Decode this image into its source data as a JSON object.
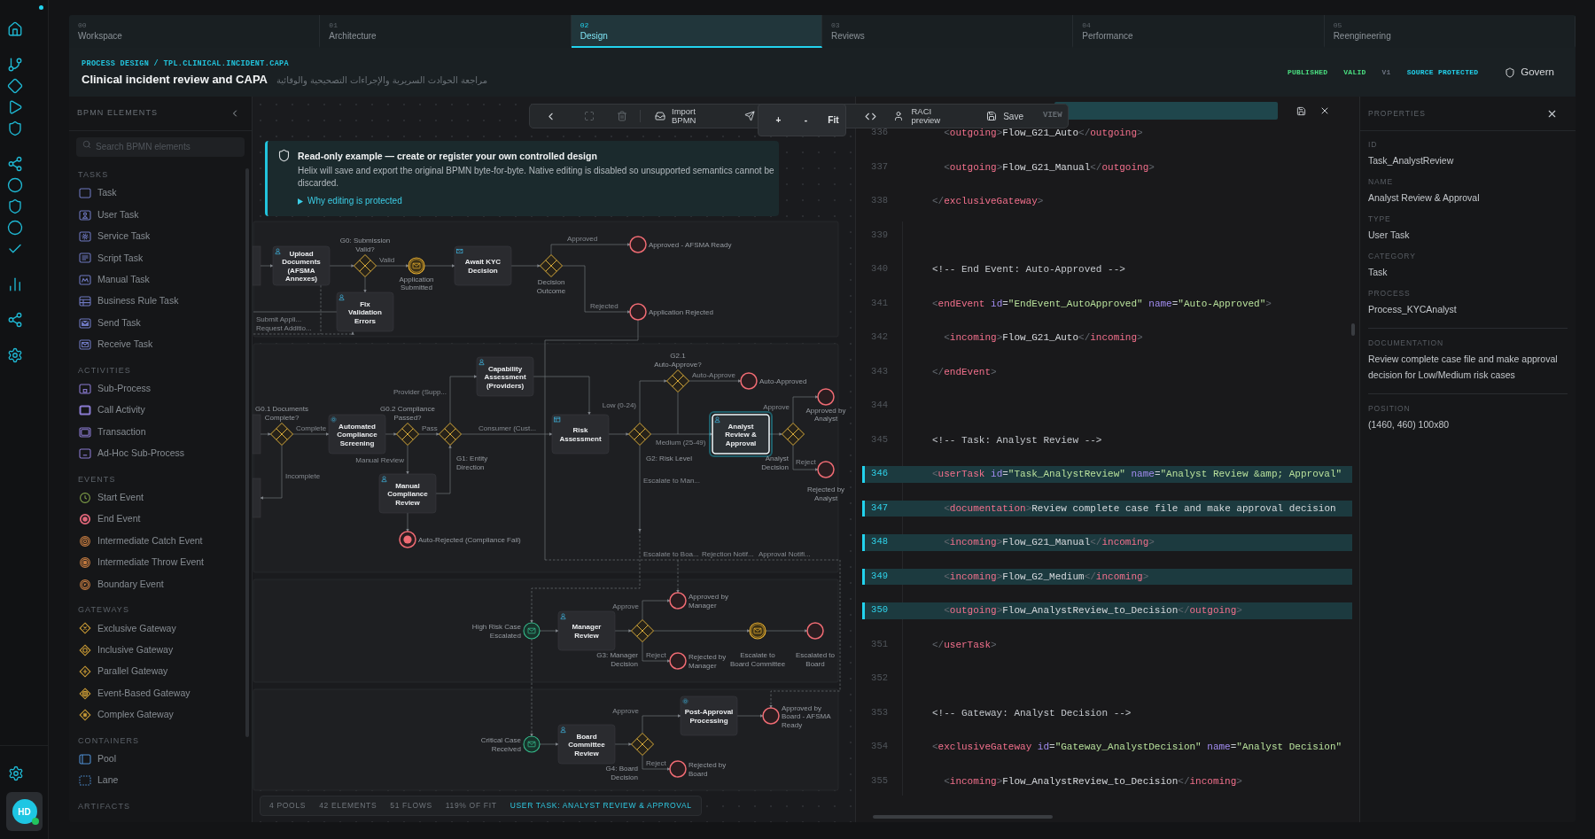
{
  "rail": {
    "avatar": {
      "initials": "HD",
      "online": true
    }
  },
  "tabs": [
    {
      "number": "00",
      "label": "Workspace",
      "selected": false
    },
    {
      "number": "01",
      "label": "Architecture",
      "selected": false
    },
    {
      "number": "02",
      "label": "Design",
      "selected": true
    },
    {
      "number": "03",
      "label": "Reviews",
      "selected": false
    },
    {
      "number": "04",
      "label": "Performance",
      "selected": false
    },
    {
      "number": "05",
      "label": "Reengineering",
      "selected": false
    }
  ],
  "header": {
    "breadcrumb": "PROCESS DESIGN / TPL.CLINICAL.INCIDENT.CAPA",
    "title": "Clinical incident review and CAPA",
    "title_arabic": "مراجعة الحوادث السريرية والإجراءات التصحيحية والوقائية",
    "badges": [
      {
        "label": "PUBLISHED",
        "color": "#4ade80"
      },
      {
        "label": "VALID",
        "color": "#4ade80"
      },
      {
        "label": "V1",
        "color": "#6b7280"
      },
      {
        "label": "SOURCE PROTECTED",
        "color": "#22d3ee"
      }
    ],
    "govern_button": "Govern"
  },
  "palette": {
    "title": "BPMN ELEMENTS",
    "search_placeholder": "Search BPMN elements",
    "sections": [
      {
        "title": "TASKS",
        "items": [
          {
            "kind": "task",
            "label": "Task"
          },
          {
            "kind": "user",
            "label": "User Task"
          },
          {
            "kind": "service",
            "label": "Service Task"
          },
          {
            "kind": "script",
            "label": "Script Task"
          },
          {
            "kind": "manual",
            "label": "Manual Task"
          },
          {
            "kind": "rule",
            "label": "Business Rule Task"
          },
          {
            "kind": "send",
            "label": "Send Task"
          },
          {
            "kind": "receive",
            "label": "Receive Task"
          }
        ]
      },
      {
        "title": "ACTIVITIES",
        "items": [
          {
            "kind": "subprocess",
            "label": "Sub-Process"
          },
          {
            "kind": "call",
            "label": "Call Activity"
          },
          {
            "kind": "transaction",
            "label": "Transaction"
          },
          {
            "kind": "adhoc",
            "label": "Ad-Hoc Sub-Process"
          }
        ]
      },
      {
        "title": "EVENTS",
        "items": [
          {
            "kind": "start",
            "label": "Start Event"
          },
          {
            "kind": "end",
            "label": "End Event"
          },
          {
            "kind": "catch",
            "label": "Intermediate Catch Event"
          },
          {
            "kind": "throw",
            "label": "Intermediate Throw Event"
          },
          {
            "kind": "boundary",
            "label": "Boundary Event"
          }
        ]
      },
      {
        "title": "GATEWAYS",
        "items": [
          {
            "kind": "exclusive",
            "label": "Exclusive Gateway"
          },
          {
            "kind": "inclusive",
            "label": "Inclusive Gateway"
          },
          {
            "kind": "parallel",
            "label": "Parallel Gateway"
          },
          {
            "kind": "eventbased",
            "label": "Event-Based Gateway"
          },
          {
            "kind": "complex",
            "label": "Complex Gateway"
          }
        ]
      },
      {
        "title": "CONTAINERS",
        "items": [
          {
            "kind": "pool",
            "label": "Pool"
          },
          {
            "kind": "lane",
            "label": "Lane"
          }
        ]
      },
      {
        "title": "ARTIFACTS"
      }
    ]
  },
  "toolbar": {
    "fullscreen_disabled": true,
    "delete_disabled": true,
    "import_label": "Import BPMN",
    "zoom_in": "+",
    "zoom_out": "-",
    "fit": "Fit",
    "raci_label": "RACI preview",
    "save_label": "Save",
    "mode": "VIEW"
  },
  "banner": {
    "title": "Read-only example — create or register your own controlled design",
    "body": "Helix will save and export the original BPMN byte-for-byte. Native editing is disabled so unsupported semantics cannot be discarded.",
    "link": "Why editing is protected"
  },
  "diagram": {
    "pools": [
      {
        "nodes": [
          {
            "kind": "gateway",
            "label": "G0: Submission Valid?",
            "selected": false
          },
          {
            "kind": "endevent",
            "label": "Approved - AFSMA Ready",
            "selected": false
          },
          {
            "kind": "usertask",
            "label": "Upload Documents (AFSMA Annexes)",
            "selected": false
          },
          {
            "kind": "receivetask",
            "label": "Await KYC Decision",
            "selected": false
          },
          {
            "kind": "messageevent",
            "label": "Application Submitted",
            "selected": false
          },
          {
            "kind": "gateway",
            "label": "Decision Outcome",
            "selected": false
          },
          {
            "kind": "usertask",
            "label": "Fix Validation Errors",
            "selected": false
          },
          {
            "kind": "endevent",
            "label": "Application Rejected",
            "selected": false
          }
        ],
        "flow_labels": [
          "Approved",
          "Valid",
          "Rejected",
          "Submit Appli...",
          "Request Additio..."
        ]
      },
      {
        "nodes": [
          {
            "kind": "gateway",
            "label": "G2.1 Auto-Approve?",
            "selected": false
          },
          {
            "kind": "usertask",
            "label": "Capability Assessment (Providers)",
            "selected": false
          },
          {
            "kind": "endevent",
            "label": "Auto-Approved",
            "selected": false
          },
          {
            "kind": "gateway",
            "label": "G0.1 Documents Complete?",
            "selected": false
          },
          {
            "kind": "gateway",
            "label": "G0.2 Compliance Passed?",
            "selected": false
          },
          {
            "kind": "endevent",
            "label": "Approved by Analyst",
            "selected": false
          },
          {
            "kind": "servicetask",
            "label": "Automated Compliance Screening",
            "selected": false
          },
          {
            "kind": "ruletask",
            "label": "Risk Assessment",
            "selected": false
          },
          {
            "kind": "usertask",
            "label": "Analyst Review & Approval",
            "selected": true
          },
          {
            "kind": "gateway",
            "label": "G1: Entity Direction",
            "selected": false
          },
          {
            "kind": "gateway",
            "label": "G2: Risk Level",
            "selected": false
          },
          {
            "kind": "gateway",
            "label": "Analyst Decision",
            "selected": false
          },
          {
            "kind": "usertask",
            "label": "Manual Compliance Review",
            "selected": false
          },
          {
            "kind": "endevent",
            "label": "Rejected by Analyst",
            "selected": false
          },
          {
            "kind": "terminateevent",
            "label": "Auto-Rejected (Compliance Fail)",
            "selected": false
          }
        ],
        "flow_labels": [
          "Auto-Approve",
          "Provider (Supp...",
          "Low (0-24)",
          "Approve",
          "Complete",
          "Pass",
          "Consumer (Cust...",
          "Medium (25-49)",
          "Manual Review",
          "Reject",
          "Incomplete",
          "Escalate to Man...",
          "Escalate to Boa...",
          "Rejection Notif...",
          "Approval Notifi..."
        ]
      },
      {
        "nodes": [
          {
            "kind": "endevent",
            "label": "Approved by Manager",
            "selected": false
          },
          {
            "kind": "messagestart",
            "label": "High Risk Case Escalated",
            "selected": false
          },
          {
            "kind": "usertask",
            "label": "Manager Review",
            "selected": false
          },
          {
            "kind": "gateway",
            "label": "G3: Manager Decision",
            "selected": false
          },
          {
            "kind": "endevent",
            "label": "Rejected by Manager",
            "selected": false
          },
          {
            "kind": "messageevent",
            "label": "Escalate to Board Committee",
            "selected": false
          },
          {
            "kind": "endevent",
            "label": "Escalated to Board",
            "selected": false
          }
        ],
        "flow_labels": [
          "Approve",
          "Reject"
        ]
      },
      {
        "nodes": [
          {
            "kind": "servicetask",
            "label": "Post-Approval Processing",
            "selected": false
          },
          {
            "kind": "endevent",
            "label": "Approved by Board - AFSMA Ready",
            "selected": false
          },
          {
            "kind": "messagestart",
            "label": "Critical Case Received",
            "selected": false
          },
          {
            "kind": "usertask",
            "label": "Board Committee Review",
            "selected": false
          },
          {
            "kind": "gateway",
            "label": "G4: Board Decision",
            "selected": false
          },
          {
            "kind": "endevent",
            "label": "Rejected by Board",
            "selected": false
          }
        ],
        "flow_labels": [
          "Approve",
          "Reject"
        ]
      }
    ]
  },
  "status_bar": {
    "stats": [
      "4 POOLS",
      "42 ELEMENTS",
      "51 FLOWS",
      "119% OF FIT"
    ],
    "selection": "USER TASK: ANALYST REVIEW & APPROVAL"
  },
  "code": {
    "lines": [
      {
        "number": "336",
        "text": "  <outgoing>Flow_G21_Auto</outgoing>",
        "highlighted": false
      },
      {
        "number": "337",
        "text": "  <outgoing>Flow_G21_Manual</outgoing>",
        "highlighted": false
      },
      {
        "number": "338",
        "text": "</exclusiveGateway>",
        "highlighted": false
      },
      {
        "number": "339",
        "highlighted": false
      },
      {
        "number": "340",
        "text": "<!-- End Event: Auto-Approved -->",
        "highlighted": false
      },
      {
        "number": "341",
        "text": "<endEvent id=\"EndEvent_AutoApproved\" name=\"Auto-Approved\">",
        "highlighted": false
      },
      {
        "number": "342",
        "text": "  <incoming>Flow_G21_Auto</incoming>",
        "highlighted": false
      },
      {
        "number": "343",
        "text": "</endEvent>",
        "highlighted": false
      },
      {
        "number": "344",
        "highlighted": false
      },
      {
        "number": "345",
        "text": "<!-- Task: Analyst Review -->",
        "highlighted": false
      },
      {
        "number": "346",
        "text": "<userTask id=\"Task_AnalystReview\" name=\"Analyst Review &amp; Approval\"",
        "highlighted": true
      },
      {
        "number": "347",
        "text": "  <documentation>Review complete case file and make approval decision",
        "highlighted": true
      },
      {
        "number": "348",
        "text": "  <incoming>Flow_G21_Manual</incoming>",
        "highlighted": true
      },
      {
        "number": "349",
        "text": "  <incoming>Flow_G2_Medium</incoming>",
        "highlighted": true
      },
      {
        "number": "350",
        "text": "  <outgoing>Flow_AnalystReview_to_Decision</outgoing>",
        "highlighted": true
      },
      {
        "number": "351",
        "text": "</userTask>",
        "highlighted": false
      },
      {
        "number": "352",
        "highlighted": false
      },
      {
        "number": "353",
        "text": "<!-- Gateway: Analyst Decision -->",
        "highlighted": false
      },
      {
        "number": "354",
        "text": "<exclusiveGateway id=\"Gateway_AnalystDecision\" name=\"Analyst Decision\"",
        "highlighted": false
      },
      {
        "number": "355",
        "text": "  <incoming>Flow_AnalystReview_to_Decision</incoming>",
        "highlighted": false
      }
    ]
  },
  "properties": {
    "title": "PROPERTIES",
    "sections": [
      {
        "fields": [
          {
            "label": "ID",
            "value": "Task_AnalystReview"
          },
          {
            "label": "NAME",
            "value": "Analyst Review & Approval"
          },
          {
            "label": "TYPE",
            "value": "User Task"
          },
          {
            "label": "CATEGORY",
            "value": "Task"
          },
          {
            "label": "PROCESS",
            "value": "Process_KYCAnalyst"
          }
        ]
      },
      {
        "fields": [
          {
            "label": "DOCUMENTATION",
            "value": "Review complete case file and make approval decision for Low/Medium risk cases"
          }
        ]
      },
      {
        "fields": [
          {
            "label": "POSITION",
            "value": "(1460, 460) 100x80"
          }
        ]
      }
    ]
  }
}
